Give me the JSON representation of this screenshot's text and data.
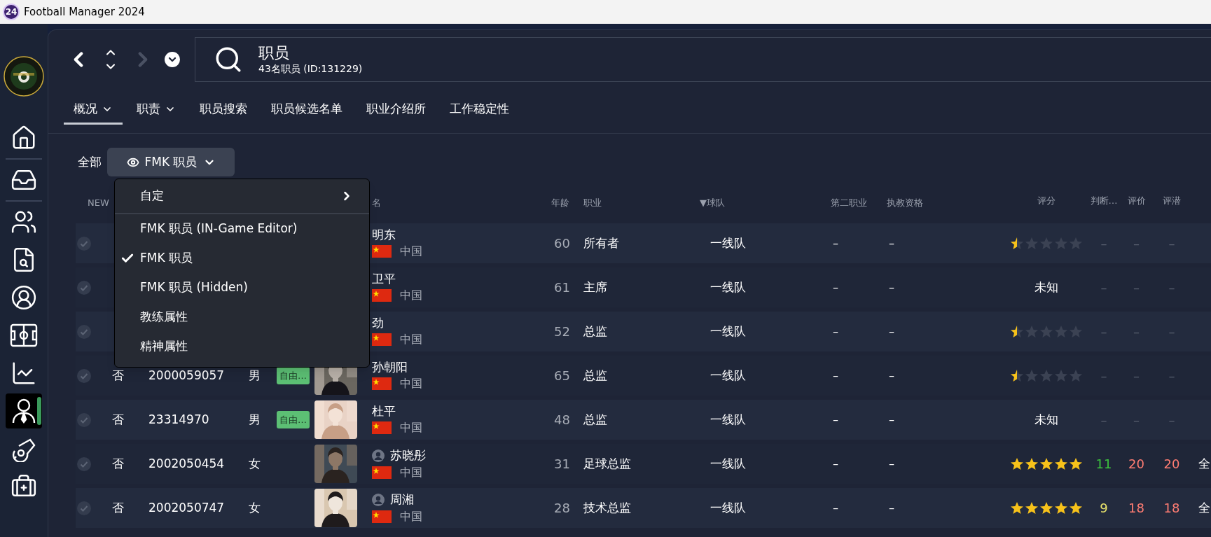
{
  "window": {
    "app_badge": "24",
    "title": "Football Manager 2024"
  },
  "sidebar": {
    "items": [
      {
        "kind": "home",
        "selected": false
      },
      {
        "kind": "inbox",
        "selected": false
      },
      {
        "kind": "people",
        "selected": false
      },
      {
        "kind": "report",
        "selected": false
      },
      {
        "kind": "scout",
        "selected": false
      },
      {
        "kind": "pitch",
        "selected": false
      },
      {
        "kind": "chart",
        "selected": false
      },
      {
        "kind": "staff",
        "selected": true
      },
      {
        "kind": "whistle",
        "selected": false
      },
      {
        "kind": "medical",
        "selected": false
      }
    ]
  },
  "nav": {
    "forward_enabled": false
  },
  "header": {
    "title": "职员",
    "subtitle": "43名职员 (ID:131229)"
  },
  "tabs": [
    {
      "label": "概况",
      "has_menu": true,
      "selected": true
    },
    {
      "label": "职责",
      "has_menu": true,
      "selected": false
    },
    {
      "label": "职员搜索",
      "has_menu": false,
      "selected": false
    },
    {
      "label": "职员候选名单",
      "has_menu": false,
      "selected": false
    },
    {
      "label": "职业介绍所",
      "has_menu": false,
      "selected": false
    },
    {
      "label": "工作稳定性",
      "has_menu": false,
      "selected": false
    }
  ],
  "filter": {
    "label": "全部",
    "view_button": "FMK 职员",
    "menu": [
      {
        "label": "自定",
        "kind": "submenu"
      },
      {
        "label": "FMK 职员 (IN-Game Editor)",
        "kind": "option",
        "checked": false
      },
      {
        "label": "FMK 职员",
        "kind": "option",
        "checked": true
      },
      {
        "label": "FMK 职员 (Hidden)",
        "kind": "option",
        "checked": false
      },
      {
        "label": "教练属性",
        "kind": "option",
        "checked": false
      },
      {
        "label": "精神属性",
        "kind": "option",
        "checked": false
      }
    ]
  },
  "table": {
    "columns": {
      "new": "NEW",
      "name": "名",
      "age": "年龄",
      "job": "职业",
      "team": "▼球队",
      "second_job": "第二职业",
      "coaching": "执教资格",
      "rating": "评分",
      "judge": "判断…",
      "eval": "评价",
      "potential": "评潜"
    },
    "rows": [
      {
        "name": "明东",
        "country": "中国",
        "age": "60",
        "job": "所有者",
        "team": "一线队",
        "second_job": "–",
        "coaching": "–",
        "stars": 0.5,
        "judge": {
          "text": "–",
          "color": "#596070"
        },
        "eval": {
          "text": "–",
          "color": "#596070"
        },
        "potential": {
          "text": "–",
          "color": "#596070"
        }
      },
      {
        "name": "卫平",
        "country": "中国",
        "age": "61",
        "job": "主席",
        "team": "一线队",
        "second_job": "–",
        "coaching": "–",
        "rating_text": "未知",
        "judge": {
          "text": "–",
          "color": "#596070"
        },
        "eval": {
          "text": "–",
          "color": "#596070"
        },
        "potential": {
          "text": "–",
          "color": "#596070"
        }
      },
      {
        "name": "劲",
        "country": "中国",
        "age": "52",
        "job": "总监",
        "team": "一线队",
        "second_job": "–",
        "coaching": "–",
        "stars": 0.5,
        "judge": {
          "text": "–",
          "color": "#596070"
        },
        "eval": {
          "text": "–",
          "color": "#596070"
        },
        "potential": {
          "text": "–",
          "color": "#596070"
        }
      },
      {
        "new": "否",
        "id": "2000059057",
        "gender": "男",
        "badge": "自由…",
        "person_icon": false,
        "name": "孙朝阳",
        "country": "中国",
        "age": "65",
        "job": "总监",
        "team": "一线队",
        "second_job": "–",
        "coaching": "–",
        "stars": 0.5,
        "judge": {
          "text": "–",
          "color": "#596070"
        },
        "eval": {
          "text": "–",
          "color": "#596070"
        },
        "potential": {
          "text": "–",
          "color": "#596070"
        }
      },
      {
        "new": "否",
        "id": "23314970",
        "gender": "男",
        "badge": "自由…",
        "person_icon": false,
        "name": "杜平",
        "country": "中国",
        "age": "48",
        "job": "总监",
        "team": "一线队",
        "second_job": "–",
        "coaching": "–",
        "rating_text": "未知",
        "judge": {
          "text": "–",
          "color": "#596070"
        },
        "eval": {
          "text": "–",
          "color": "#596070"
        },
        "potential": {
          "text": "–",
          "color": "#596070"
        }
      },
      {
        "new": "否",
        "id": "2002050454",
        "gender": "女",
        "person_icon": true,
        "name": "苏晓彤",
        "country": "中国",
        "age": "31",
        "job": "足球总监",
        "team": "一线队",
        "second_job": "–",
        "coaching": "–",
        "stars": 5,
        "judge": {
          "text": "11",
          "color": "#3dc43d"
        },
        "eval": {
          "text": "20",
          "color": "#ff7d73"
        },
        "potential": {
          "text": "20",
          "color": "#ff7d73"
        },
        "type": "全"
      },
      {
        "new": "否",
        "id": "2002050747",
        "gender": "女",
        "person_icon": true,
        "name": "周湘",
        "country": "中国",
        "age": "28",
        "job": "技术总监",
        "team": "一线队",
        "second_job": "–",
        "coaching": "–",
        "stars": 5,
        "judge": {
          "text": "9",
          "color": "#e8e36c"
        },
        "eval": {
          "text": "18",
          "color": "#ff7d73"
        },
        "potential": {
          "text": "18",
          "color": "#ff7d73"
        },
        "type": "全"
      }
    ]
  }
}
